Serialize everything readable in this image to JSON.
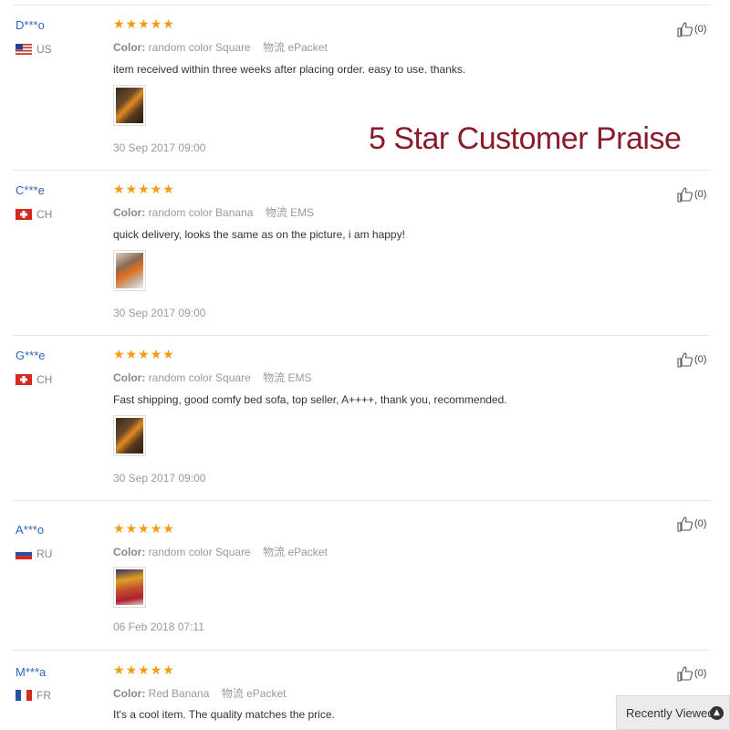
{
  "banner": "5 Star Customer Praise",
  "labels": {
    "color": "Color:",
    "logistics": "物流"
  },
  "reviews": [
    {
      "name": "D***o",
      "country": "US",
      "rating": 5,
      "color": "random color Square",
      "shipping": "ePacket",
      "text": "item received within three weeks after placing order. easy to use. thanks.",
      "date": "30 Sep 2017 09:00",
      "helpful": "(0)"
    },
    {
      "name": "C***e",
      "country": "CH",
      "rating": 5,
      "color": "random color Banana",
      "shipping": "EMS",
      "text": "quick delivery, looks the same as on the picture, i am happy!",
      "date": "30 Sep 2017 09:00",
      "helpful": "(0)"
    },
    {
      "name": "G***e",
      "country": "CH",
      "rating": 5,
      "color": "random color Square",
      "shipping": "EMS",
      "text": "Fast shipping, good comfy bed sofa, top seller, A++++, thank you, recommended.",
      "date": "30 Sep 2017 09:00",
      "helpful": "(0)"
    },
    {
      "name": "A***o",
      "country": "RU",
      "rating": 5,
      "color": "random color Square",
      "shipping": "ePacket",
      "text": "",
      "date": "06 Feb 2018 07:11",
      "helpful": "(0)"
    },
    {
      "name": "M***a",
      "country": "FR",
      "rating": 5,
      "color": "Red Banana",
      "shipping": "ePacket",
      "text": "It's a cool item. The quality matches the price.",
      "date": "",
      "helpful": "(0)"
    }
  ],
  "recently_viewed": "Recently Viewed",
  "colors": {
    "star": "#f39c12",
    "name": "#2a6ab5",
    "banner": "#8b1a2b"
  }
}
